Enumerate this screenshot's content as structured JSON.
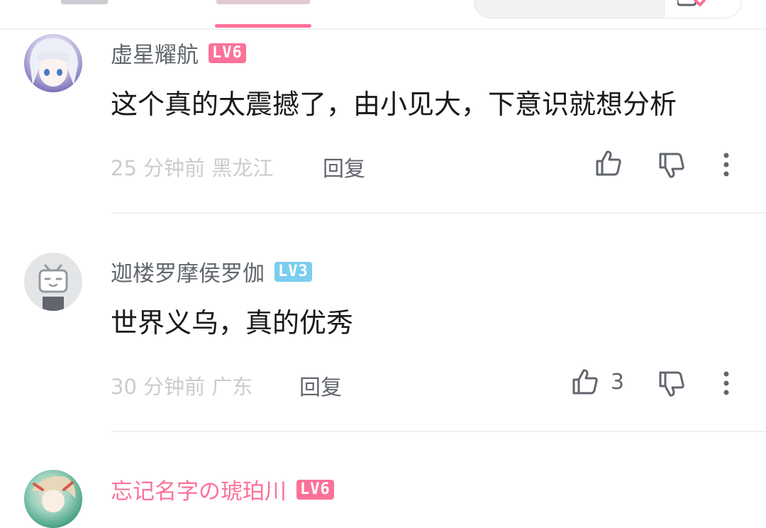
{
  "search": {
    "placeholder": ""
  },
  "comments": [
    {
      "username": "虚星耀航",
      "level": "LV6",
      "level_color": "#fb7299",
      "username_color": "#61666d",
      "content": "这个真的太震撼了，由小见大，下意识就想分析",
      "time": "25 分钟前",
      "location": "黑龙江",
      "reply_label": "回复",
      "like_count": ""
    },
    {
      "username": "迦楼罗摩侯罗伽",
      "level": "LV3",
      "level_color": "#7bcdef",
      "username_color": "#61666d",
      "content": "世界义乌，真的优秀",
      "time": "30 分钟前",
      "location": "广东",
      "reply_label": "回复",
      "like_count": "3"
    },
    {
      "username": "忘记名字の琥珀川",
      "level": "LV6",
      "level_color": "#fb7299",
      "username_color": "#fb7299"
    }
  ],
  "colors": {
    "accent": "#fb7299",
    "divider": "#f1f2f3"
  }
}
